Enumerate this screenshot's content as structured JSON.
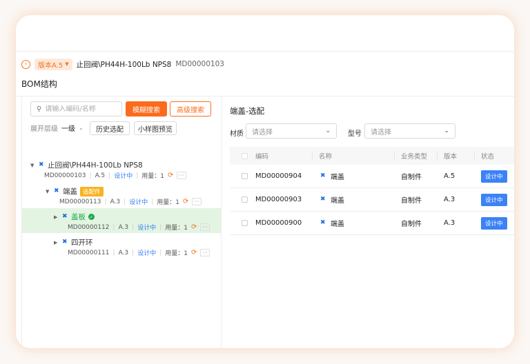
{
  "header": {
    "version_badge": "版本A.5",
    "title": "止回阀\\PH44H-100Lb NPS8",
    "code": "MD00000103"
  },
  "section_title": "BOM结构",
  "left": {
    "search_placeholder": "请输入编码/名称",
    "fuzzy_search": "模糊搜索",
    "advanced_search": "高级搜索",
    "expand_label": "展开层级",
    "expand_value": "一级",
    "history_btn": "历史选配",
    "thumb_btn": "小样图预览",
    "tree": [
      {
        "name": "止回阀\\PH44H-100Lb NPS8",
        "code": "MD00000103",
        "version": "A.5",
        "status": "设计中",
        "usage": "用量：1",
        "tag": "",
        "ok": false
      },
      {
        "name": "端盖",
        "code": "MD00000113",
        "version": "A.3",
        "status": "设计中",
        "usage": "用量：1",
        "tag": "选配件",
        "ok": false
      },
      {
        "name": "盖板",
        "code": "MD00000112",
        "version": "A.3",
        "status": "设计中",
        "usage": "用量：1",
        "tag": "",
        "ok": true
      },
      {
        "name": "四开环",
        "code": "MD00000111",
        "version": "A.3",
        "status": "设计中",
        "usage": "用量：1",
        "tag": "",
        "ok": false
      }
    ]
  },
  "right": {
    "title": "端盖-选配",
    "material_label": "材质",
    "model_label": "型号",
    "select_placeholder": "请选择",
    "columns": [
      "编码",
      "名称",
      "业务类型",
      "版本",
      "状态"
    ],
    "rows": [
      {
        "code": "MD00000904",
        "name": "端盖",
        "type": "自制件",
        "version": "A.5",
        "status": "设计中"
      },
      {
        "code": "MD00000903",
        "name": "端盖",
        "type": "自制件",
        "version": "A.3",
        "status": "设计中"
      },
      {
        "code": "MD00000900",
        "name": "端盖",
        "type": "自制件",
        "version": "A.3",
        "status": "设计中"
      }
    ]
  },
  "colors": {
    "accent": "#fa6b1c",
    "status_blue": "#3b82f6",
    "selected_bg": "#e3f4e3",
    "tag_yellow": "#f9b21e"
  }
}
